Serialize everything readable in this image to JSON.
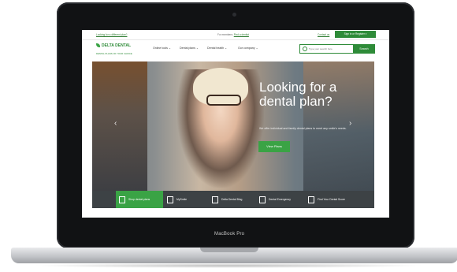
{
  "device": {
    "brand": "MacBook Pro"
  },
  "topbar": {
    "left_link": "Looking for a different plan?",
    "mid_text": "For members:",
    "mid_link": "Find a dentist",
    "contact": "Contact us",
    "signin": "Sign in or Register ▾"
  },
  "nav": {
    "logo": "DELTA DENTAL",
    "logo_sub": "DENTAL PLANS OF YOUR CHOICE",
    "items": [
      "Online tools ⌄",
      "Dental plans ⌄",
      "Dental health ⌄",
      "Our company ⌄"
    ],
    "search_placeholder": "Type your search here",
    "search_button": "Search"
  },
  "hero": {
    "title": "Looking for a dental plan?",
    "description": "We offer individual and family dental plans to meet any smile's needs.",
    "button": "View Plans",
    "prev": "‹",
    "next": "›"
  },
  "quickbar": [
    {
      "label": "Shop dental plans",
      "icon": "document-icon"
    },
    {
      "label": "MySmile",
      "icon": "toothbrush-icon"
    },
    {
      "label": "Delta Dental Blog",
      "icon": "person-icon"
    },
    {
      "label": "Dental Emergency",
      "icon": "emergency-icon"
    },
    {
      "label": "Find Your Dental Score",
      "icon": "checklist-icon"
    }
  ],
  "colors": {
    "brand_green": "#2e8b38",
    "accent_green": "#3aa345",
    "quickbar_bg": "#3d4245"
  }
}
